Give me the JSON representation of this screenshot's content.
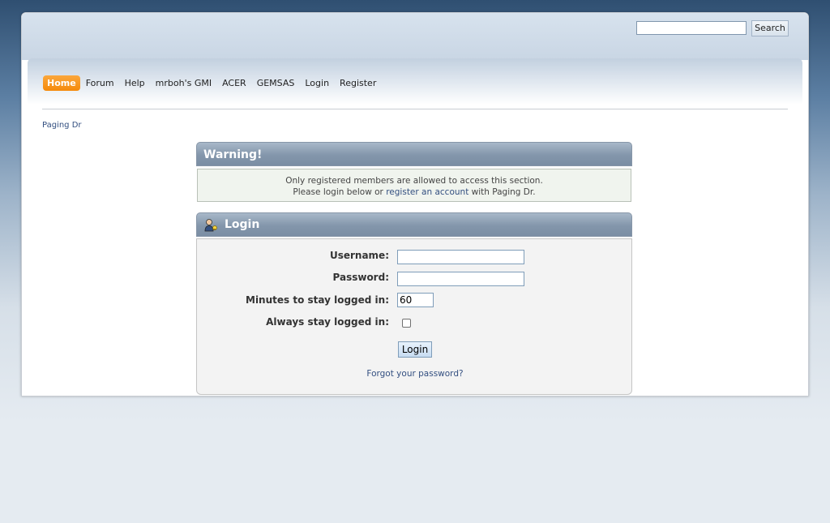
{
  "search": {
    "value": "",
    "button_label": "Search"
  },
  "menu": {
    "items": [
      {
        "label": "Home",
        "active": true
      },
      {
        "label": "Forum"
      },
      {
        "label": "Help"
      },
      {
        "label": "mrboh's GMI"
      },
      {
        "label": "ACER"
      },
      {
        "label": "GEMSAS"
      },
      {
        "label": "Login"
      },
      {
        "label": "Register"
      }
    ]
  },
  "breadcrumb": {
    "label": "Paging Dr"
  },
  "warning": {
    "title": "Warning!",
    "line1": "Only registered members are allowed to access this section.",
    "line2_prefix": "Please login below or ",
    "line2_link": "register an account",
    "line2_suffix": " with Paging Dr."
  },
  "login": {
    "title": "Login",
    "username_label": "Username:",
    "password_label": "Password:",
    "minutes_label": "Minutes to stay logged in:",
    "minutes_value": "60",
    "always_label": "Always stay logged in:",
    "button_label": "Login",
    "forgot_label": "Forgot your password?"
  },
  "colors": {
    "accent": "#f58a0a",
    "link": "#334f80",
    "catbar": "#8396ab"
  }
}
